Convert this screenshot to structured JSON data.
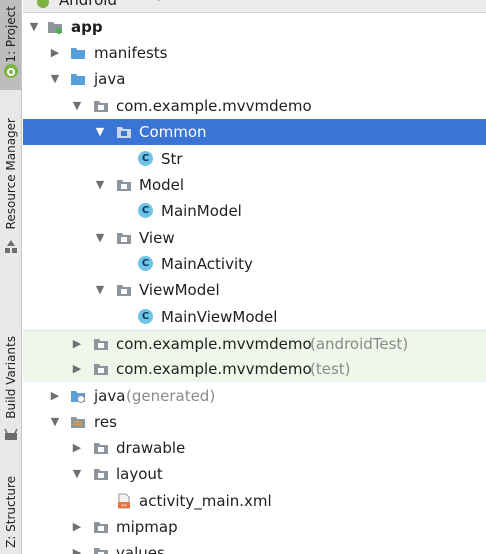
{
  "side_tabs": {
    "project": "1: Project",
    "resource_manager": "Resource Manager",
    "build_variants": "Build Variants",
    "structure": "Z: Structure"
  },
  "header": {
    "view_selector": "Android"
  },
  "tree": {
    "app": "app",
    "manifests": "manifests",
    "java": "java",
    "pkg_main": "com.example.mvvmdemo",
    "common": "Common",
    "str": "Str",
    "model": "Model",
    "main_model": "MainModel",
    "view": "View",
    "main_activity": "MainActivity",
    "viewmodel": "ViewModel",
    "main_viewmodel": "MainViewModel",
    "pkg_android_test": "com.example.mvvmdemo",
    "android_test_suffix": "(androidTest)",
    "pkg_test": "com.example.mvvmdemo",
    "test_suffix": "(test)",
    "java_generated": "java",
    "generated_suffix": "(generated)",
    "res": "res",
    "drawable": "drawable",
    "layout": "layout",
    "activity_main": "activity_main.xml",
    "mipmap": "mipmap",
    "values": "values"
  },
  "colors": {
    "selection": "#3a75d6",
    "test_background": "#eef7e9",
    "folder_blue": "#5aa0d8",
    "package_gray": "#8f959c",
    "class_circle": "#6ec3e8"
  }
}
